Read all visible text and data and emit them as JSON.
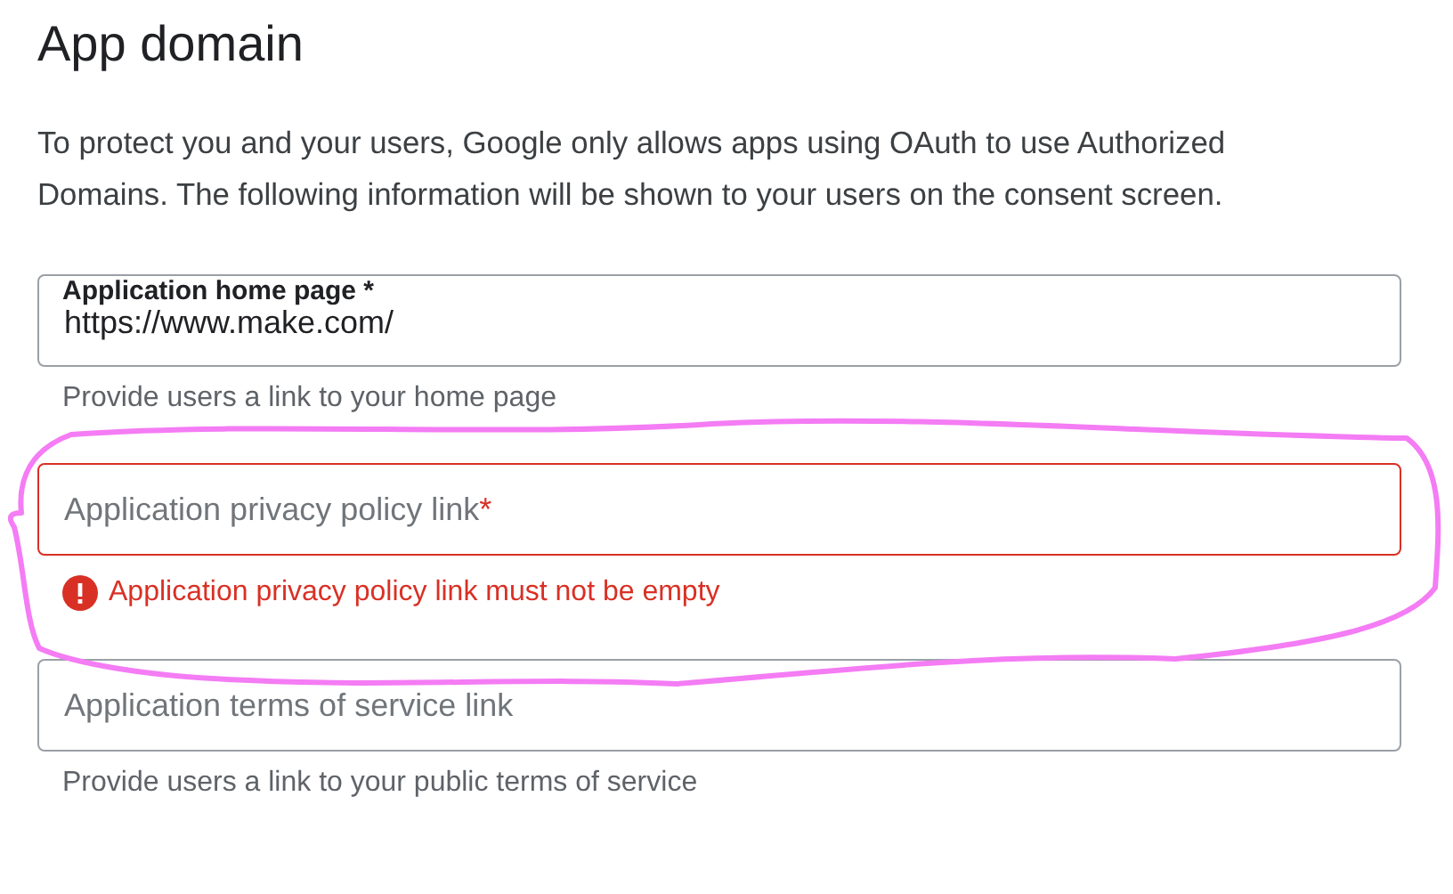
{
  "heading": "App domain",
  "description": "To protect you and your users, Google only allows apps using OAuth to use Authorized Domains. The following information will be shown to your users on the consent screen.",
  "fields": [
    {
      "label": "Application home page",
      "required_mark": "*",
      "value": "https://www.make.com/",
      "helper": "Provide users a link to your home page",
      "error": false
    },
    {
      "label": "Application privacy policy link",
      "required_mark": "*",
      "error": true,
      "error_message": "Application privacy policy link must not be empty"
    },
    {
      "label": "Application terms of service link",
      "helper": "Provide users a link to your public terms of service",
      "error": false
    }
  ],
  "annotation": {
    "kind": "scribble"
  }
}
